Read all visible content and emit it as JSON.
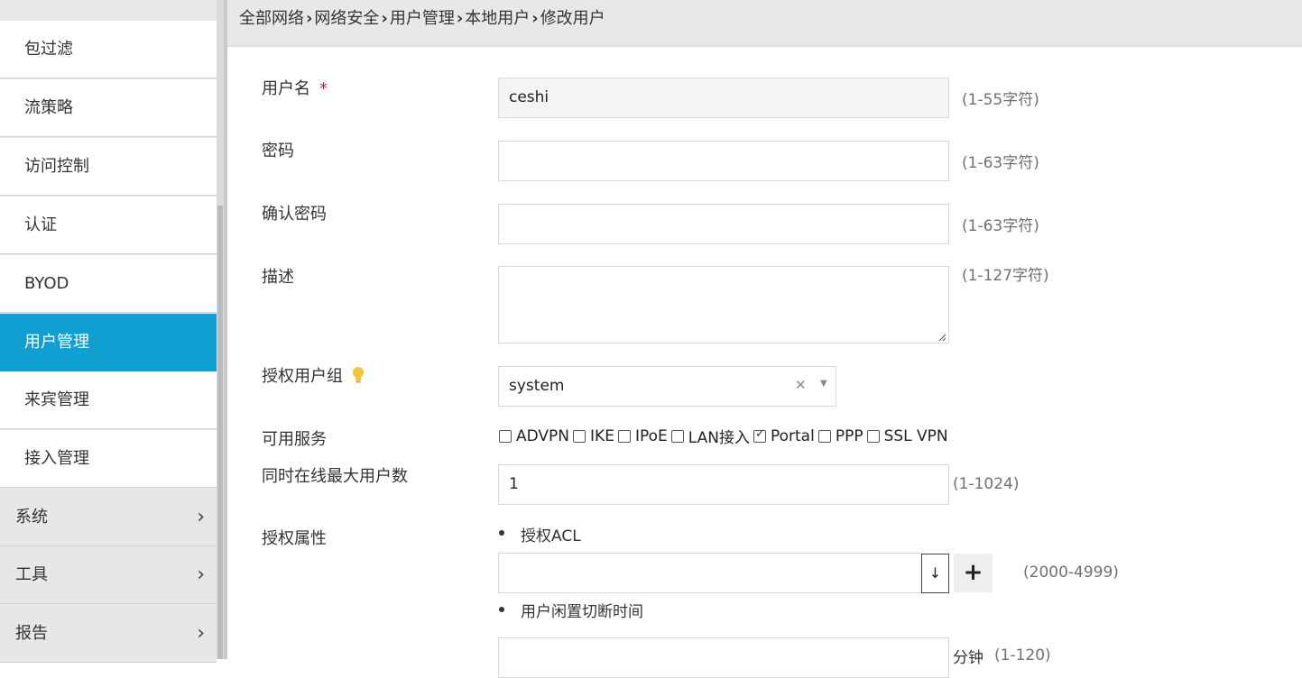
{
  "sidebar": {
    "items": [
      {
        "label": "包过滤"
      },
      {
        "label": "流策略"
      },
      {
        "label": "访问控制"
      },
      {
        "label": "认证"
      },
      {
        "label": "BYOD"
      },
      {
        "label": "用户管理",
        "active": true
      },
      {
        "label": "来宾管理"
      },
      {
        "label": "接入管理"
      }
    ],
    "groups": [
      {
        "label": "系统"
      },
      {
        "label": "工具"
      },
      {
        "label": "报告"
      }
    ]
  },
  "breadcrumb": [
    "全部网络",
    "网络安全",
    "用户管理",
    "本地用户",
    "修改用户"
  ],
  "form": {
    "username": {
      "label": "用户名",
      "required_mark": "*",
      "value": "ceshi",
      "hint": "(1-55字符)"
    },
    "password": {
      "label": "密码",
      "value": "",
      "hint": "(1-63字符)"
    },
    "confirm_password": {
      "label": "确认密码",
      "value": "",
      "hint": "(1-63字符)"
    },
    "description": {
      "label": "描述",
      "value": "",
      "hint": "(1-127字符)"
    },
    "auth_group": {
      "label": "授权用户组",
      "value": "system"
    },
    "services": {
      "label": "可用服务",
      "options": [
        {
          "label": "ADVPN",
          "checked": false
        },
        {
          "label": "IKE",
          "checked": false
        },
        {
          "label": "IPoE",
          "checked": false
        },
        {
          "label": "LAN接入",
          "checked": false
        },
        {
          "label": "Portal",
          "checked": true
        },
        {
          "label": "PPP",
          "checked": false
        },
        {
          "label": "SSL VPN",
          "checked": false
        }
      ]
    },
    "max_online": {
      "label": "同时在线最大用户数",
      "value": "1",
      "hint": "(1-1024)"
    },
    "auth_attrs": {
      "label": "授权属性",
      "acl": {
        "label": "授权ACL",
        "value": "",
        "hint": "(2000-4999)",
        "add_button": "+"
      },
      "idle_cut": {
        "label": "用户闲置切断时间",
        "value": "",
        "unit": "分钟",
        "hint": "(1-120)"
      }
    }
  },
  "colors": {
    "accent": "#109fd1",
    "required": "#c0282f",
    "bulb": "#f5c43b"
  }
}
